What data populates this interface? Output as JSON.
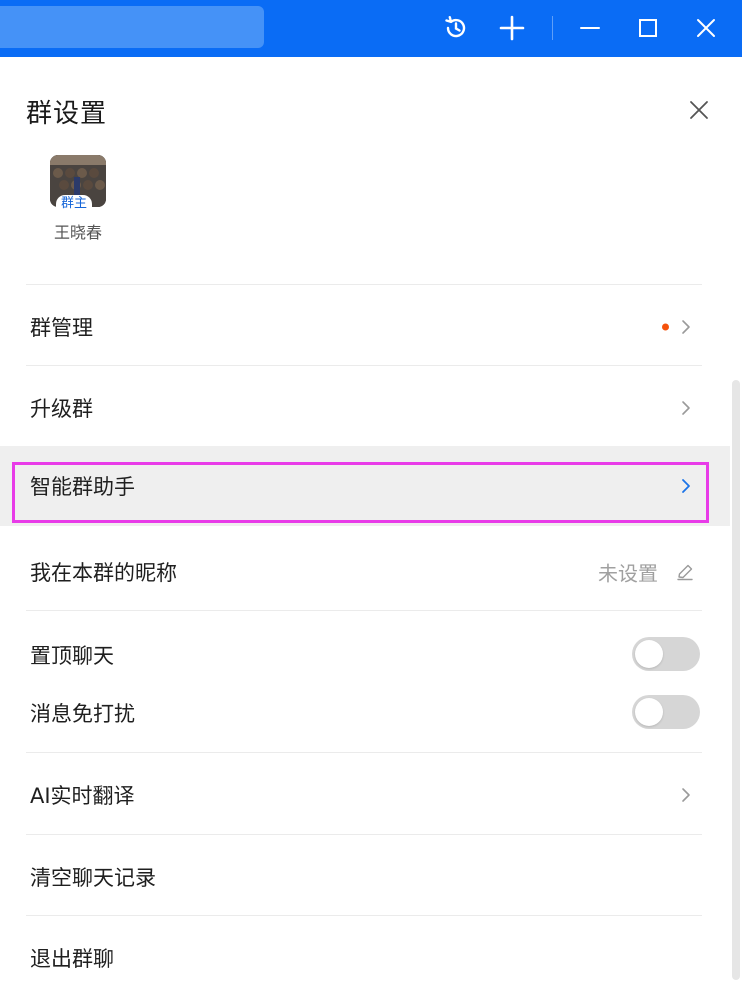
{
  "titlebar": {
    "accent_color": "#0a6cf5",
    "icons": [
      "history-icon",
      "plus-icon",
      "minimize-icon",
      "maximize-icon",
      "close-icon"
    ]
  },
  "panel": {
    "title": "群设置",
    "member": {
      "badge": "群主",
      "name": "王晓春"
    },
    "rows": {
      "manage": "群管理",
      "upgrade": "升级群",
      "assistant": "智能群助手",
      "nickname": "我在本群的昵称",
      "nickname_value": "未设置",
      "pin": "置顶聊天",
      "mute": "消息免打扰",
      "translate": "AI实时翻译",
      "clear": "清空聊天记录",
      "exit": "退出群聊"
    },
    "toggles": {
      "pin_on": false,
      "mute_on": false
    },
    "notification_dot_color": "#f5520c",
    "highlight_color": "#e83be8"
  }
}
